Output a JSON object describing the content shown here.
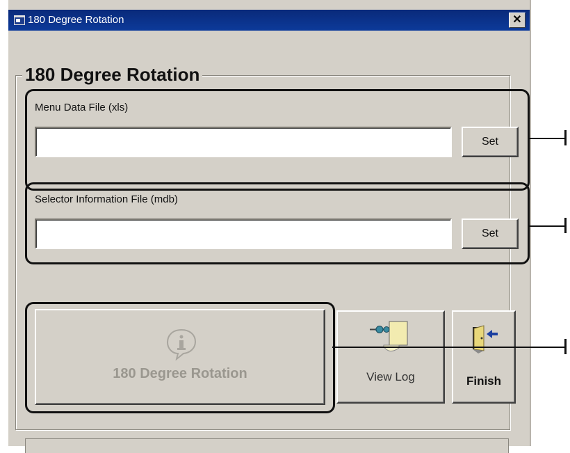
{
  "window": {
    "title": "180 Degree Rotation",
    "close_glyph": "✕"
  },
  "group": {
    "title": "180 Degree Rotation"
  },
  "menu_file": {
    "label": "Menu Data File (xls)",
    "value": "",
    "set_label": "Set"
  },
  "selector_file": {
    "label": "Selector Information File (mdb)",
    "value": "",
    "set_label": "Set"
  },
  "actions": {
    "rotate_label": "180 Degree Rotation",
    "view_log_label": "View Log",
    "finish_label": "Finish"
  },
  "callouts": {
    "marker": "I"
  },
  "icons": {
    "rotate": "info-icon",
    "view_log": "pushpin-note-icon",
    "finish": "exit-door-icon",
    "app": "window-app-icon"
  }
}
